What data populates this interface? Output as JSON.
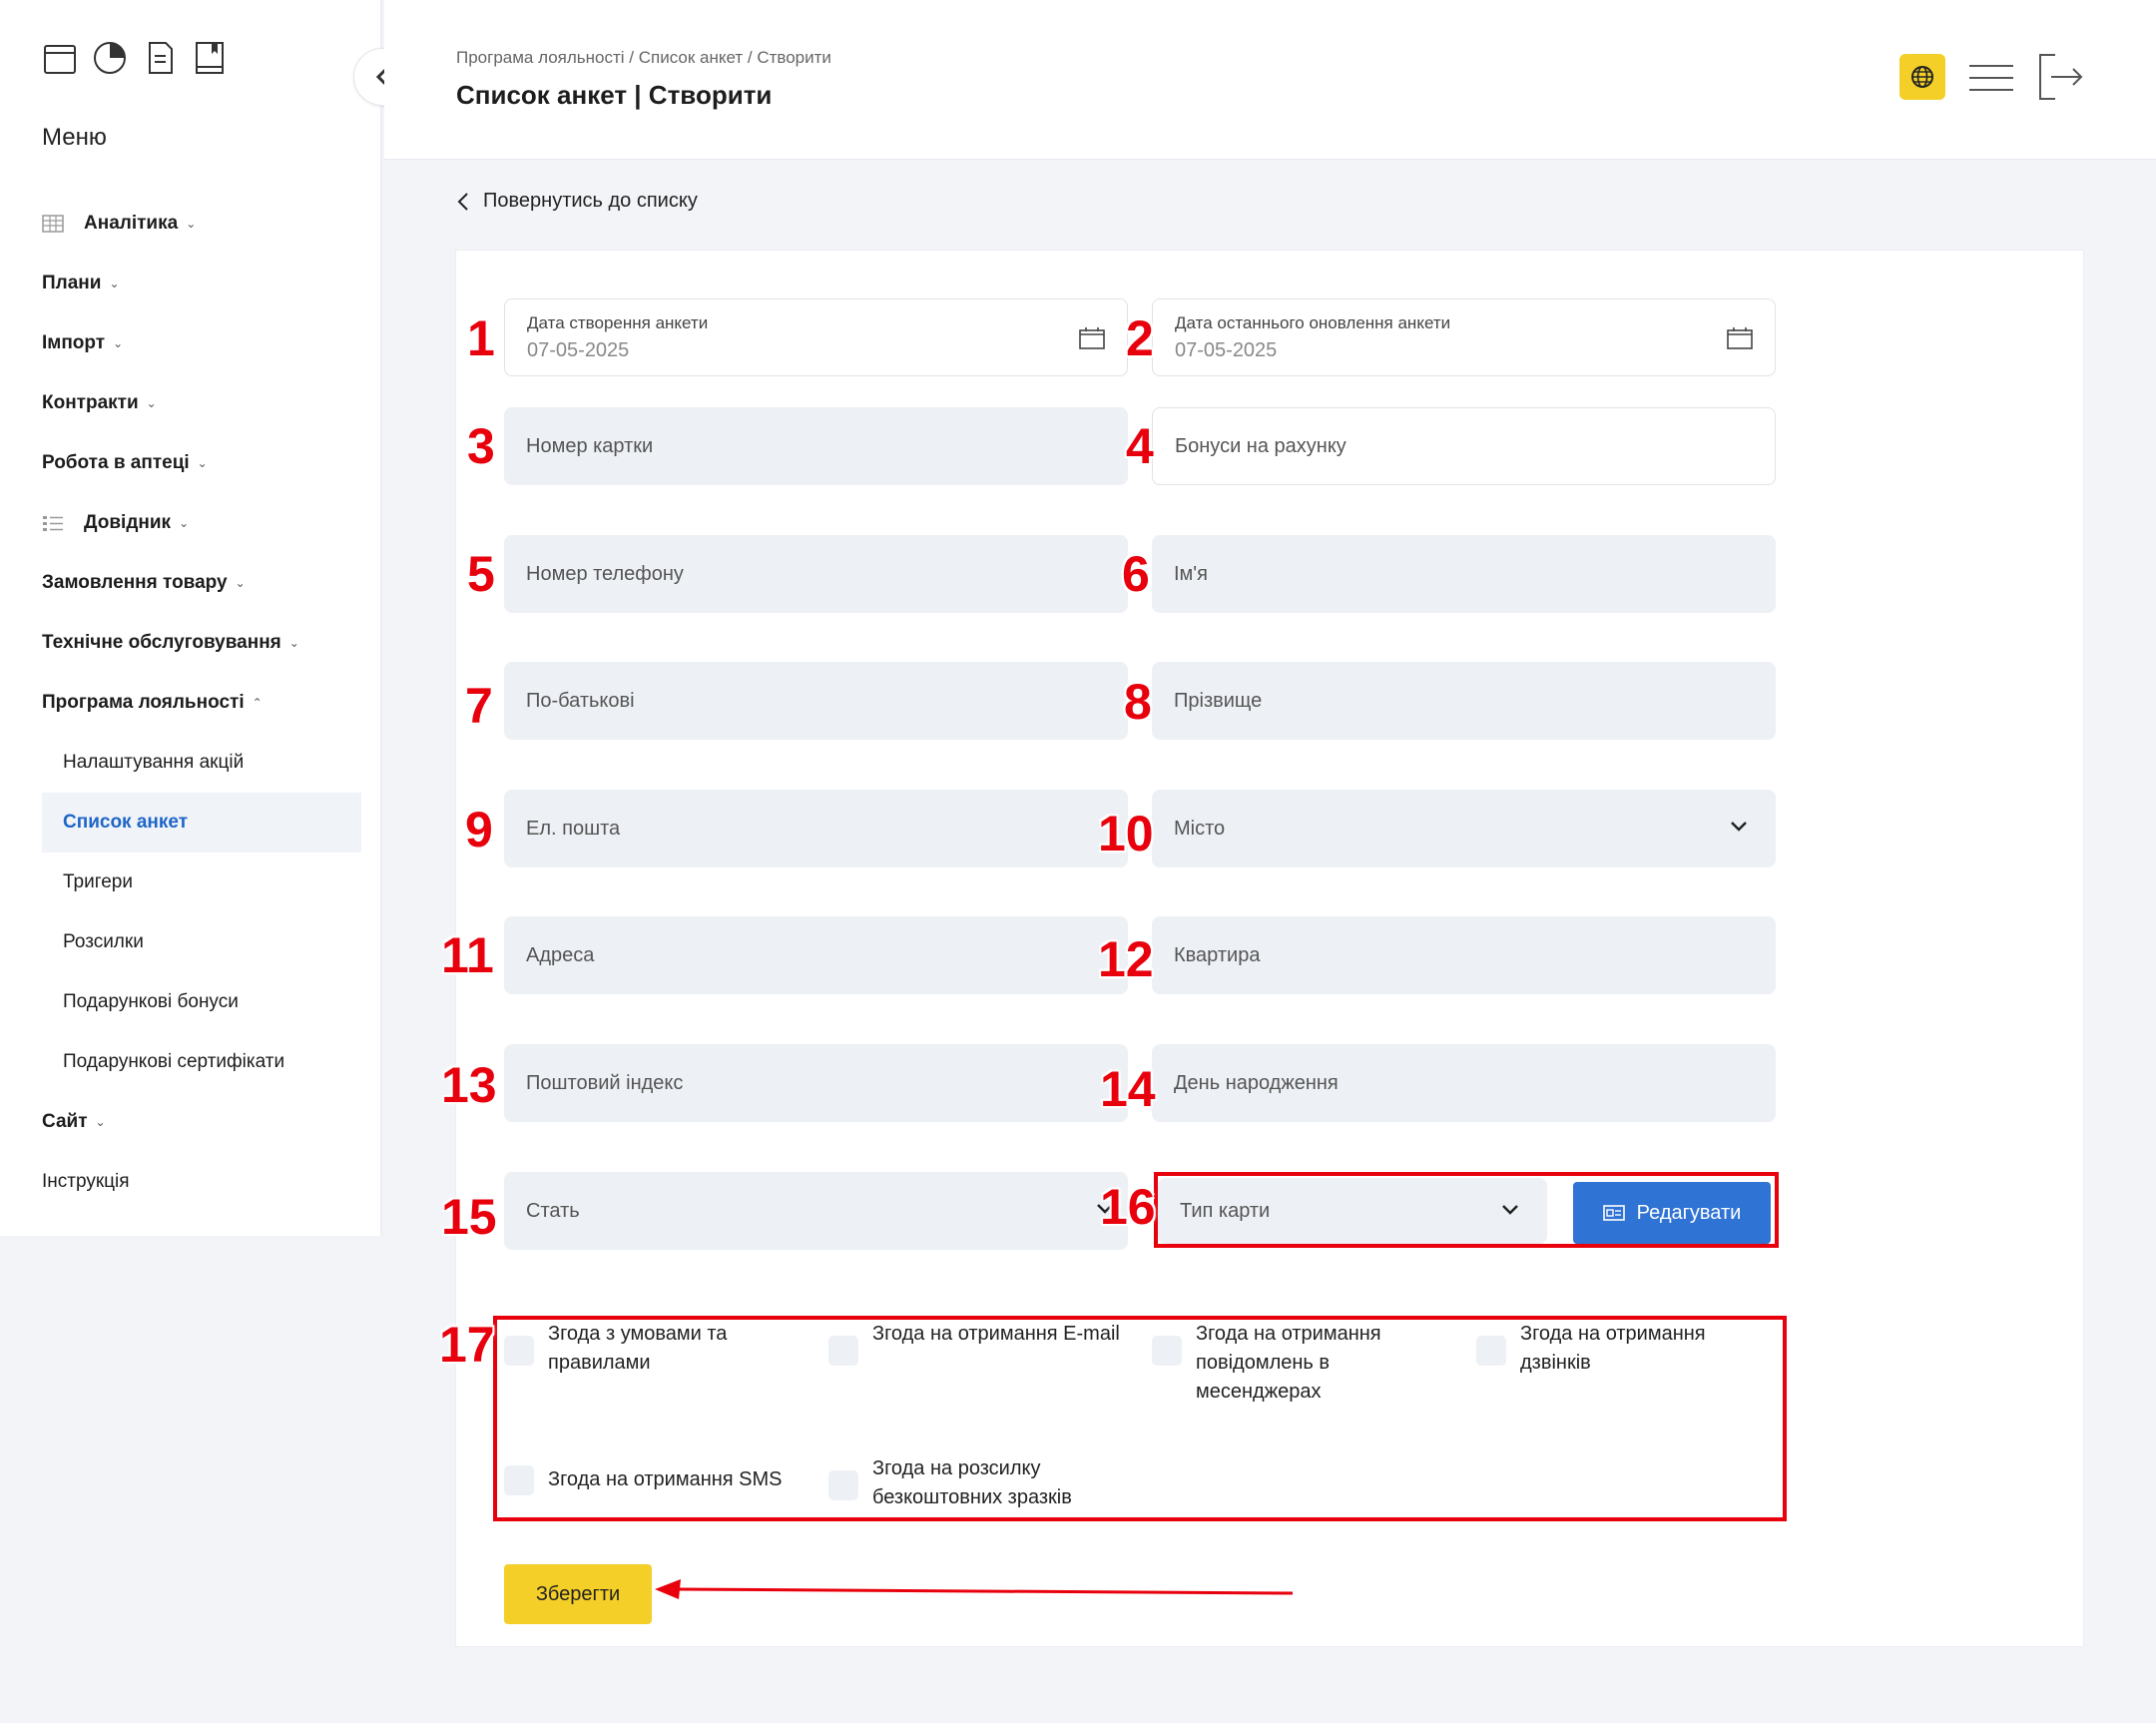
{
  "sidebar": {
    "menu_title": "Меню",
    "items": [
      {
        "label": "Аналітика",
        "icon": "table-icon"
      },
      {
        "label": "Плани"
      },
      {
        "label": "Імпорт"
      },
      {
        "label": "Контракти"
      },
      {
        "label": "Робота в аптеці"
      },
      {
        "label": "Довідник",
        "icon": "list-icon"
      },
      {
        "label": "Замовлення товару"
      },
      {
        "label": "Технічне обслуговування"
      },
      {
        "label": "Програма лояльності"
      }
    ],
    "sub_items": [
      {
        "label": "Налаштування акцій"
      },
      {
        "label": "Список анкет"
      },
      {
        "label": "Тригери"
      },
      {
        "label": "Розсилки"
      },
      {
        "label": "Подарункові бонуси"
      },
      {
        "label": "Подарункові сертифікати"
      }
    ],
    "site": "Сайт",
    "instruction": "Інструкція"
  },
  "header": {
    "breadcrumb": "Програма лояльності / Список анкет / Створити",
    "title": "Список анкет | Створити"
  },
  "back_link": "Повернутись до списку",
  "form": {
    "created_label": "Дата створення анкети",
    "created_value": "07-05-2025",
    "updated_label": "Дата останнього оновлення анкети",
    "updated_value": "07-05-2025",
    "card_number": "Номер картки",
    "bonuses": "Бонуси на рахунку",
    "phone": "Номер телефону",
    "first_name": "Ім'я",
    "patronymic": "По-батькові",
    "last_name": "Прізвище",
    "email": "Ел. пошта",
    "city": "Місто",
    "address": "Адреса",
    "apartment": "Квартира",
    "postal": "Поштовий індекс",
    "birthday": "День народження",
    "gender": "Стать",
    "card_type": "Тип карти",
    "edit_button": "Редагувати",
    "consents": {
      "terms": "Згода з умовами та правилами",
      "email": "Згода на отримання E-mail",
      "messengers": "Згода на отримання повідомлень в месенджерах",
      "calls": "Згода на отримання дзвінків",
      "sms": "Згода на отримання SMS",
      "samples": "Згода на розсилку безкоштовних зразків"
    },
    "save_button": "Зберегти"
  },
  "annotations": [
    "1",
    "2",
    "3",
    "4",
    "5",
    "6",
    "7",
    "8",
    "9",
    "10",
    "11",
    "12",
    "13",
    "14",
    "15",
    "16",
    "17"
  ],
  "colors": {
    "accent_yellow": "#f3cf28",
    "accent_blue": "#2f73d5",
    "annotation_red": "#e8000c"
  }
}
